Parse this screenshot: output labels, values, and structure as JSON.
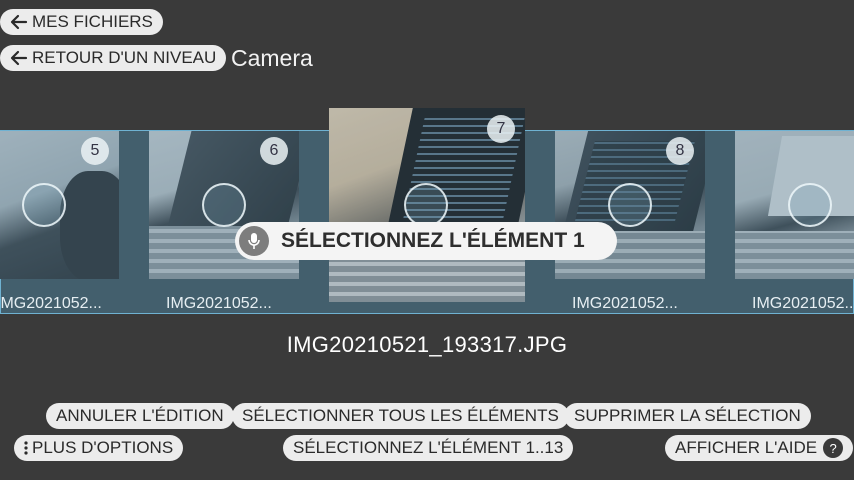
{
  "nav": {
    "my_files_label": "MES FICHIERS",
    "back_level_label": "RETOUR D'UN NIVEAU",
    "folder_title": "Camera"
  },
  "gallery": {
    "items": [
      {
        "badge": "5",
        "filename": "IMG2021052..."
      },
      {
        "badge": "6",
        "filename": "IMG2021052..."
      },
      {
        "badge": "7",
        "filename": ""
      },
      {
        "badge": "8",
        "filename": "IMG2021052..."
      },
      {
        "badge": "",
        "filename": "IMG2021052..."
      }
    ],
    "selected_filename": "IMG20210521_193317.JPG"
  },
  "voice_hint": {
    "text": "SÉLECTIONNEZ L'ÉLÉMENT 1"
  },
  "actions": {
    "cancel_edit": "ANNULER L'ÉDITION",
    "select_all": "SÉLECTIONNER TOUS LES ÉLÉMENTS",
    "clear_selection": "SUPPRIMER LA SÉLECTION",
    "more_options": "PLUS D'OPTIONS",
    "select_range": "SÉLECTIONNEZ L'ÉLÉMENT 1..13",
    "show_help": "AFFICHER L'AIDE",
    "help_glyph": "?"
  },
  "colors": {
    "background": "#3a3a3a",
    "strip": "#435f6d",
    "strip_border": "#6fb2d2",
    "pill": "#ececec"
  },
  "icons": {
    "arrow": "arrow-left-icon",
    "mic": "microphone-icon",
    "more": "vertical-dots-icon",
    "help": "question-icon"
  }
}
